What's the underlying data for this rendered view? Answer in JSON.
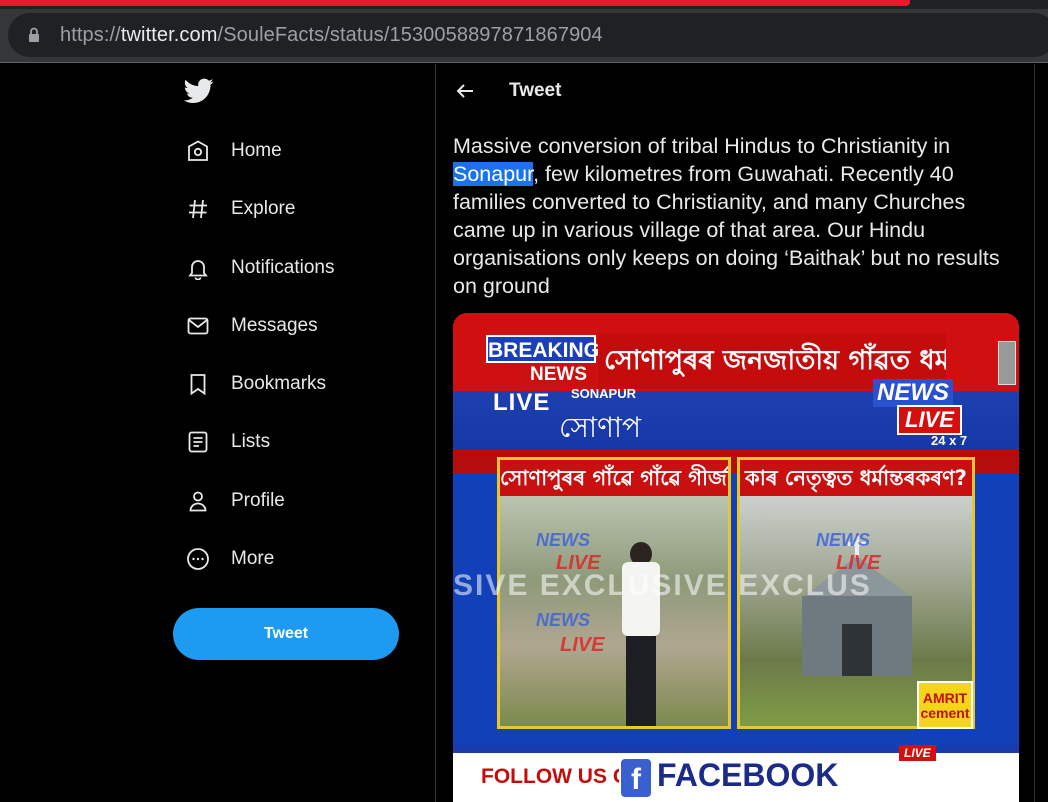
{
  "browser": {
    "url_prefix": "https://",
    "url_domain": "twitter.com",
    "url_path": "/SouleFacts/status/1530058897871867904"
  },
  "sidebar": {
    "logo_icon": "twitter-bird-icon",
    "items": [
      {
        "label": "Home",
        "icon": "home-icon"
      },
      {
        "label": "Explore",
        "icon": "hashtag-icon"
      },
      {
        "label": "Notifications",
        "icon": "bell-icon"
      },
      {
        "label": "Messages",
        "icon": "envelope-icon"
      },
      {
        "label": "Bookmarks",
        "icon": "bookmark-icon"
      },
      {
        "label": "Lists",
        "icon": "list-icon"
      },
      {
        "label": "Profile",
        "icon": "person-icon"
      },
      {
        "label": "More",
        "icon": "more-circle-icon"
      }
    ],
    "tweet_button": "Tweet"
  },
  "main": {
    "header_title": "Tweet",
    "tweet": {
      "text_before": "Massive conversion of tribal Hindus to Christianity in ",
      "highlight": "Sonapur",
      "text_after": ", few kilometres from Guwahati. Recently 40 families converted to Christianity, and many Churches came up in various village of that area. Our Hindu organisations only keeps on doing ‘Baithak’ but no results on ground"
    },
    "media": {
      "breaking": "BREAKING",
      "news": "NEWS",
      "headline": "সোণাপুৰৰ জনজাতীয় গাঁৱত ধৰ্মান্তৰকৰণ",
      "live": "LIVE",
      "location": "SONAPUR",
      "location_local": "সোণাপ",
      "logo_news": "NEWS",
      "logo_live": "LIVE",
      "logo_24x7": "24 x 7",
      "panel1_caption": "সোণাপুৰৰ গাঁৱে গাঁৱে গীৰ্জাঘৰ",
      "panel2_caption": "কাৰ নেতৃত্বত ধৰ্মান্তৰকৰণ?",
      "watermark": "SIVE  EXCLUSIVE  EXCLUS",
      "wm_news": "NEWS",
      "wm_live": "LIVE",
      "sponsor_line1": "AMRIT",
      "sponsor_line2": "cement",
      "follow": "FOLLOW US ON",
      "fb_letter": "f",
      "facebook": "FACEBOOK",
      "bottom_live": "LIVE"
    }
  }
}
